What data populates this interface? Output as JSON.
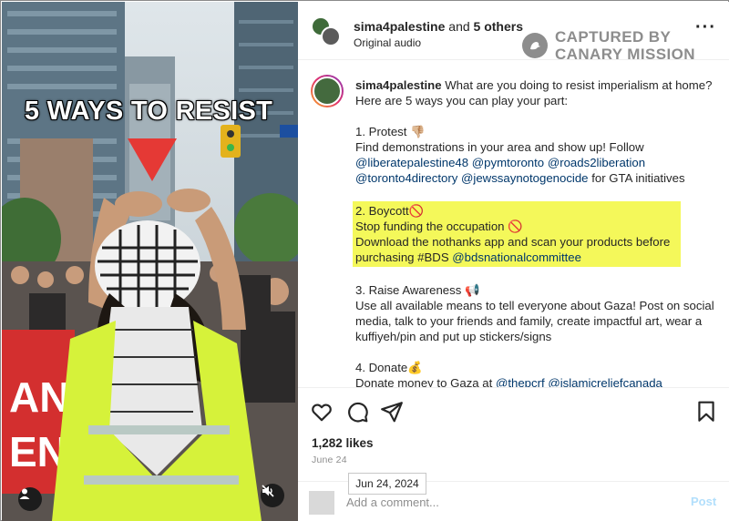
{
  "media": {
    "overlay_title": "5 WAYS TO RESIST",
    "tag_icon": "user-tag-icon",
    "mute_icon": "sound-off-icon"
  },
  "header": {
    "username": "sima4palestine",
    "collab_joiner": " and ",
    "collab_others": "5 others",
    "audio": "Original audio",
    "more_icon": "more-dots-icon"
  },
  "watermark": {
    "line1": "CAPTURED BY",
    "line2": "CANARY MISSION",
    "icon": "canary-bird-icon"
  },
  "caption": {
    "username": "sima4palestine",
    "intro": " What are you doing to resist imperialism at home? Here are 5 ways you can play your part:",
    "protest": {
      "heading": "1. Protest 👎🏼",
      "body": "Find demonstrations in your area and show up! Follow ",
      "links": [
        "@liberatepalestine48",
        "@pymtoronto",
        "@roads2liberation",
        "@toronto4directory",
        "@jewssaynotogenocide"
      ],
      "tail": " for GTA initiatives"
    },
    "boycott": {
      "heading": "2. Boycott🚫",
      "line1": "Stop funding the occupation 🚫",
      "line2": "Download the nothanks app and scan your products before purchasing #BDS ",
      "link": "@bdsnationalcommittee"
    },
    "awareness": {
      "heading": "3. Raise Awareness 📢",
      "body": "Use all available means to tell everyone about Gaza! Post on social media, talk to your friends and family, create impactful art, wear a kuffiyeh/pin and put up stickers/signs"
    },
    "donate": {
      "heading": "4. Donate💰",
      "body": "Donate money to Gaza at ",
      "links": [
        "@thepcrf",
        "@islamicreliefcanada"
      ]
    }
  },
  "actions": {
    "icons": [
      "heart-icon",
      "comment-icon",
      "share-icon",
      "bookmark-icon"
    ],
    "likes": "1,282 likes",
    "date": "June 24",
    "tooltip": "Jun 24, 2024"
  },
  "comment": {
    "placeholder": "Add a comment...",
    "post_label": "Post"
  },
  "colors": {
    "highlight": "#f4f85a",
    "link": "#00376b",
    "vest": "#d6f23a",
    "banner_red": "#d32f2f",
    "watermark_gray": "#8d8d8d",
    "post_disabled": "#b2dffc"
  }
}
